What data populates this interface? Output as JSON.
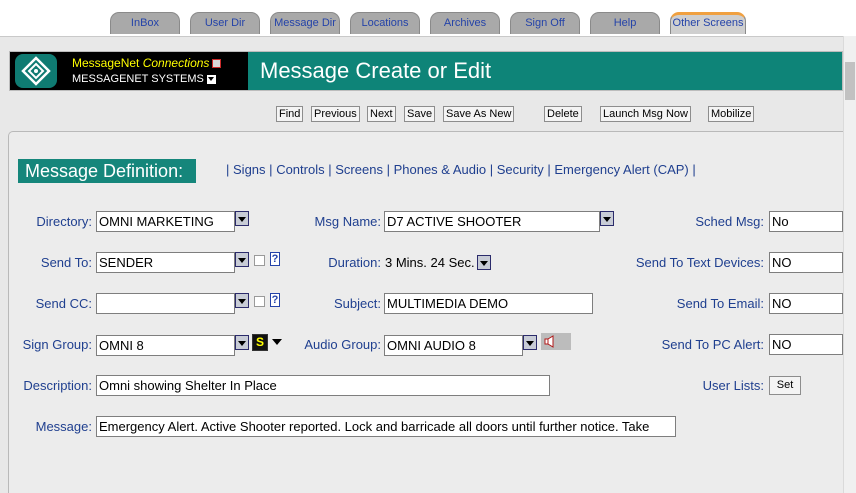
{
  "tabs": [
    {
      "label": "InBox"
    },
    {
      "label": "User Dir"
    },
    {
      "label": "Message Dir"
    },
    {
      "label": "Locations"
    },
    {
      "label": "Archives"
    },
    {
      "label": "Sign Off"
    },
    {
      "label": "Help"
    },
    {
      "label": "Other Screens"
    }
  ],
  "logo": {
    "brand": "MessageNet",
    "product": "Connections",
    "company": "MESSAGENET SYSTEMS"
  },
  "page_title": "Message Create or Edit",
  "toolbar": {
    "find": "Find",
    "previous": "Previous",
    "next": "Next",
    "save": "Save",
    "save_as_new": "Save As New",
    "delete": "Delete",
    "launch": "Launch Msg Now",
    "mobilize": "Mobilize"
  },
  "section_title": "Message Definition:",
  "nav": {
    "sep": "|",
    "signs": "Signs",
    "controls": "Controls",
    "screens": "Screens",
    "phones_audio": "Phones & Audio",
    "security": "Security",
    "emergency": "Emergency Alert (CAP)"
  },
  "form": {
    "directory": {
      "label": "Directory:",
      "value": "OMNI MARKETING"
    },
    "msg_name": {
      "label": "Msg Name:",
      "value": "D7 ACTIVE SHOOTER"
    },
    "sched_msg": {
      "label": "Sched Msg:",
      "value": "No"
    },
    "send_to": {
      "label": "Send To:",
      "value": "SENDER"
    },
    "duration": {
      "label": "Duration:",
      "value": "3 Mins. 24 Sec."
    },
    "send_text": {
      "label": "Send To Text Devices:",
      "value": "NO"
    },
    "send_cc": {
      "label": "Send CC:",
      "value": ""
    },
    "subject": {
      "label": "Subject:",
      "value": "MULTIMEDIA DEMO"
    },
    "send_email": {
      "label": "Send To Email:",
      "value": "NO"
    },
    "sign_group": {
      "label": "Sign Group:",
      "value": "OMNI 8"
    },
    "audio_group": {
      "label": "Audio Group:",
      "value": "OMNI AUDIO 8"
    },
    "send_pc": {
      "label": "Send To PC Alert:",
      "value": "NO"
    },
    "description": {
      "label": "Description:",
      "value": "Omni showing Shelter In Place"
    },
    "user_lists": {
      "label": "User Lists:",
      "button": "Set"
    },
    "message": {
      "label": "Message:",
      "value": "Emergency Alert.  Active Shooter reported.  Lock and barricade all doors until further notice.  Take"
    }
  },
  "help_glyph": "?",
  "sign_icon_glyph": "S"
}
